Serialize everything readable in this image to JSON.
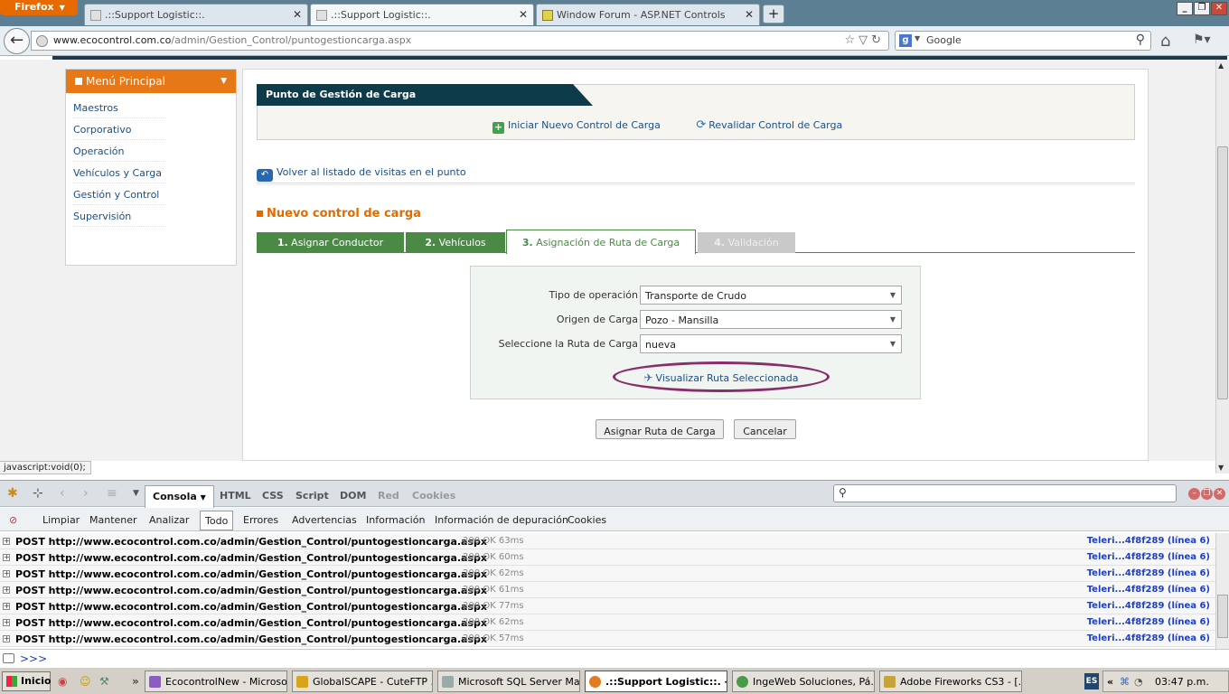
{
  "browser": {
    "menu_button": "Firefox",
    "tabs": [
      {
        "title": ".::Support Logistic::."
      },
      {
        "title": ".::Support Logistic::."
      },
      {
        "title": "Window Forum - ASP.NET Controls"
      }
    ],
    "url_domain": "www.ecocontrol.com.co",
    "url_path": "/admin/Gestion_Control/puntogestioncarga.aspx",
    "search_placeholder": "Google",
    "status_text": "javascript:void(0);"
  },
  "sidebar": {
    "title": "Menú Principal",
    "items": [
      {
        "label": "Maestros"
      },
      {
        "label": "Corporativo"
      },
      {
        "label": "Operación"
      },
      {
        "label": "Vehículos y Carga"
      },
      {
        "label": "Gestión y Control"
      },
      {
        "label": "Supervisión"
      }
    ]
  },
  "main": {
    "title": "Punto de Gestión de Carga",
    "actions": {
      "new_control": "Iniciar Nuevo Control de Carga",
      "revalidate": "Revalidar Control de Carga"
    },
    "back_link": "Volver al listado de visitas en el punto",
    "section_title": "Nuevo control de carga",
    "wizard_tabs": [
      {
        "num": "1.",
        "label": "Asignar Conductor"
      },
      {
        "num": "2.",
        "label": "Vehículos"
      },
      {
        "num": "3.",
        "label": "Asignación de Ruta de Carga"
      },
      {
        "num": "4.",
        "label": "Validación"
      }
    ],
    "form": {
      "operation_type_label": "Tipo de operación",
      "operation_type_value": "Transporte de Crudo",
      "origin_label": "Origen de Carga",
      "origin_value": "Pozo - Mansilla",
      "route_label": "Seleccione la Ruta de Carga",
      "route_value": "nueva",
      "view_route_link": "Visualizar Ruta Seleccionada"
    },
    "buttons": {
      "assign": "Asignar Ruta de Carga",
      "cancel": "Cancelar"
    }
  },
  "firebug": {
    "panels": [
      "Consola",
      "HTML",
      "CSS",
      "Script",
      "DOM",
      "Red",
      "Cookies"
    ],
    "filters": [
      "Limpiar",
      "Mantener",
      "Analizar",
      "Todo",
      "Errores",
      "Advertencias",
      "Información",
      "Información de depuración",
      "Cookies"
    ],
    "log": [
      {
        "request": "POST http://www.ecocontrol.com.co/admin/Gestion_Control/puntogestioncarga.aspx",
        "status": "200 OK 63ms",
        "source": "Teleri...4f8f289 (línea 6)"
      },
      {
        "request": "POST http://www.ecocontrol.com.co/admin/Gestion_Control/puntogestioncarga.aspx",
        "status": "200 OK 60ms",
        "source": "Teleri...4f8f289 (línea 6)"
      },
      {
        "request": "POST http://www.ecocontrol.com.co/admin/Gestion_Control/puntogestioncarga.aspx",
        "status": "200 OK 62ms",
        "source": "Teleri...4f8f289 (línea 6)"
      },
      {
        "request": "POST http://www.ecocontrol.com.co/admin/Gestion_Control/puntogestioncarga.aspx",
        "status": "200 OK 61ms",
        "source": "Teleri...4f8f289 (línea 6)"
      },
      {
        "request": "POST http://www.ecocontrol.com.co/admin/Gestion_Control/puntogestioncarga.aspx",
        "status": "200 OK 77ms",
        "source": "Teleri...4f8f289 (línea 6)"
      },
      {
        "request": "POST http://www.ecocontrol.com.co/admin/Gestion_Control/puntogestioncarga.aspx",
        "status": "200 OK 62ms",
        "source": "Teleri...4f8f289 (línea 6)"
      },
      {
        "request": "POST http://www.ecocontrol.com.co/admin/Gestion_Control/puntogestioncarga.aspx",
        "status": "200 OK 57ms",
        "source": "Teleri...4f8f289 (línea 6)"
      }
    ],
    "prompt": ">>>"
  },
  "taskbar": {
    "start": "Inicio",
    "tasks": [
      {
        "label": "EcocontrolNew - Microso..."
      },
      {
        "label": "GlobalSCAPE - CuteFTP ..."
      },
      {
        "label": "Microsoft SQL Server Ma..."
      },
      {
        "label": ".::Support Logistic::. - ..."
      },
      {
        "label": "IngeWeb Soluciones, Pá..."
      },
      {
        "label": "Adobe Fireworks CS3 - [..."
      }
    ],
    "language": "ES",
    "clock": "03:47 p.m."
  },
  "colors": {
    "menu_header": "#e77817",
    "title_bar": "#0e3b4a",
    "wizard_tab": "#4a8a45",
    "section_title": "#e06c00",
    "highlight_ellipse": "#8a2e6b"
  }
}
